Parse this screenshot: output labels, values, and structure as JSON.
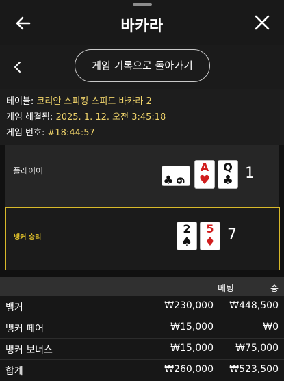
{
  "header": {
    "title": "바카라",
    "back_icon": "arrow-left-icon",
    "close_icon": "close-icon"
  },
  "nav": {
    "back_icon": "chevron-left-icon",
    "history_button": "게임 기록으로 돌아가기"
  },
  "info": {
    "table_label": "테이블:",
    "table_value": "코리안 스피킹 스피드 바카라 2",
    "resolved_label": "게임 해결됨:",
    "resolved_value": "2025. 1. 12. 오전 3:45:18",
    "game_no_label": "게임 번호:",
    "game_no_value": "#18:44:57"
  },
  "player": {
    "label": "플레이어",
    "score": "1",
    "cards": [
      {
        "rank": "6",
        "suit": "♣",
        "color": "black"
      },
      {
        "rank": "A",
        "suit": "♥",
        "color": "red"
      },
      {
        "rank": "Q",
        "suit": "♣",
        "color": "black"
      }
    ]
  },
  "banker": {
    "label": "뱅커 승리",
    "score": "7",
    "border_color": "#d8b92a",
    "cards": [
      {
        "rank": "2",
        "suit": "♠",
        "color": "black"
      },
      {
        "rank": "5",
        "suit": "♦",
        "color": "red"
      }
    ]
  },
  "bets_table": {
    "headers": {
      "bet": "베팅",
      "win": "승"
    },
    "rows": [
      {
        "name": "뱅커",
        "bet": "₩230,000",
        "win": "₩448,500"
      },
      {
        "name": "뱅커 페어",
        "bet": "₩15,000",
        "win": "₩0"
      },
      {
        "name": "뱅커 보너스",
        "bet": "₩15,000",
        "win": "₩75,000"
      },
      {
        "name": "합계",
        "bet": "₩260,000",
        "win": "₩523,500"
      }
    ]
  }
}
